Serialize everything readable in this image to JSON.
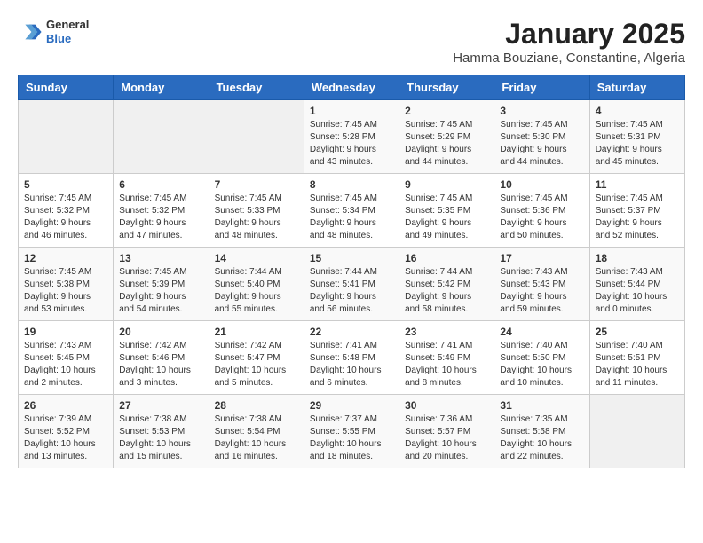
{
  "header": {
    "logo_line1": "General",
    "logo_line2": "Blue",
    "title": "January 2025",
    "subtitle": "Hamma Bouziane, Constantine, Algeria"
  },
  "weekdays": [
    "Sunday",
    "Monday",
    "Tuesday",
    "Wednesday",
    "Thursday",
    "Friday",
    "Saturday"
  ],
  "weeks": [
    [
      {
        "day": "",
        "empty": true
      },
      {
        "day": "",
        "empty": true
      },
      {
        "day": "",
        "empty": true
      },
      {
        "day": "1",
        "rise": "7:45 AM",
        "set": "5:28 PM",
        "daylight": "9 hours and 43 minutes."
      },
      {
        "day": "2",
        "rise": "7:45 AM",
        "set": "5:29 PM",
        "daylight": "9 hours and 44 minutes."
      },
      {
        "day": "3",
        "rise": "7:45 AM",
        "set": "5:30 PM",
        "daylight": "9 hours and 44 minutes."
      },
      {
        "day": "4",
        "rise": "7:45 AM",
        "set": "5:31 PM",
        "daylight": "9 hours and 45 minutes."
      }
    ],
    [
      {
        "day": "5",
        "rise": "7:45 AM",
        "set": "5:32 PM",
        "daylight": "9 hours and 46 minutes."
      },
      {
        "day": "6",
        "rise": "7:45 AM",
        "set": "5:32 PM",
        "daylight": "9 hours and 47 minutes."
      },
      {
        "day": "7",
        "rise": "7:45 AM",
        "set": "5:33 PM",
        "daylight": "9 hours and 48 minutes."
      },
      {
        "day": "8",
        "rise": "7:45 AM",
        "set": "5:34 PM",
        "daylight": "9 hours and 48 minutes."
      },
      {
        "day": "9",
        "rise": "7:45 AM",
        "set": "5:35 PM",
        "daylight": "9 hours and 49 minutes."
      },
      {
        "day": "10",
        "rise": "7:45 AM",
        "set": "5:36 PM",
        "daylight": "9 hours and 50 minutes."
      },
      {
        "day": "11",
        "rise": "7:45 AM",
        "set": "5:37 PM",
        "daylight": "9 hours and 52 minutes."
      }
    ],
    [
      {
        "day": "12",
        "rise": "7:45 AM",
        "set": "5:38 PM",
        "daylight": "9 hours and 53 minutes."
      },
      {
        "day": "13",
        "rise": "7:45 AM",
        "set": "5:39 PM",
        "daylight": "9 hours and 54 minutes."
      },
      {
        "day": "14",
        "rise": "7:44 AM",
        "set": "5:40 PM",
        "daylight": "9 hours and 55 minutes."
      },
      {
        "day": "15",
        "rise": "7:44 AM",
        "set": "5:41 PM",
        "daylight": "9 hours and 56 minutes."
      },
      {
        "day": "16",
        "rise": "7:44 AM",
        "set": "5:42 PM",
        "daylight": "9 hours and 58 minutes."
      },
      {
        "day": "17",
        "rise": "7:43 AM",
        "set": "5:43 PM",
        "daylight": "9 hours and 59 minutes."
      },
      {
        "day": "18",
        "rise": "7:43 AM",
        "set": "5:44 PM",
        "daylight": "10 hours and 0 minutes."
      }
    ],
    [
      {
        "day": "19",
        "rise": "7:43 AM",
        "set": "5:45 PM",
        "daylight": "10 hours and 2 minutes."
      },
      {
        "day": "20",
        "rise": "7:42 AM",
        "set": "5:46 PM",
        "daylight": "10 hours and 3 minutes."
      },
      {
        "day": "21",
        "rise": "7:42 AM",
        "set": "5:47 PM",
        "daylight": "10 hours and 5 minutes."
      },
      {
        "day": "22",
        "rise": "7:41 AM",
        "set": "5:48 PM",
        "daylight": "10 hours and 6 minutes."
      },
      {
        "day": "23",
        "rise": "7:41 AM",
        "set": "5:49 PM",
        "daylight": "10 hours and 8 minutes."
      },
      {
        "day": "24",
        "rise": "7:40 AM",
        "set": "5:50 PM",
        "daylight": "10 hours and 10 minutes."
      },
      {
        "day": "25",
        "rise": "7:40 AM",
        "set": "5:51 PM",
        "daylight": "10 hours and 11 minutes."
      }
    ],
    [
      {
        "day": "26",
        "rise": "7:39 AM",
        "set": "5:52 PM",
        "daylight": "10 hours and 13 minutes."
      },
      {
        "day": "27",
        "rise": "7:38 AM",
        "set": "5:53 PM",
        "daylight": "10 hours and 15 minutes."
      },
      {
        "day": "28",
        "rise": "7:38 AM",
        "set": "5:54 PM",
        "daylight": "10 hours and 16 minutes."
      },
      {
        "day": "29",
        "rise": "7:37 AM",
        "set": "5:55 PM",
        "daylight": "10 hours and 18 minutes."
      },
      {
        "day": "30",
        "rise": "7:36 AM",
        "set": "5:57 PM",
        "daylight": "10 hours and 20 minutes."
      },
      {
        "day": "31",
        "rise": "7:35 AM",
        "set": "5:58 PM",
        "daylight": "10 hours and 22 minutes."
      },
      {
        "day": "",
        "empty": true
      }
    ]
  ]
}
